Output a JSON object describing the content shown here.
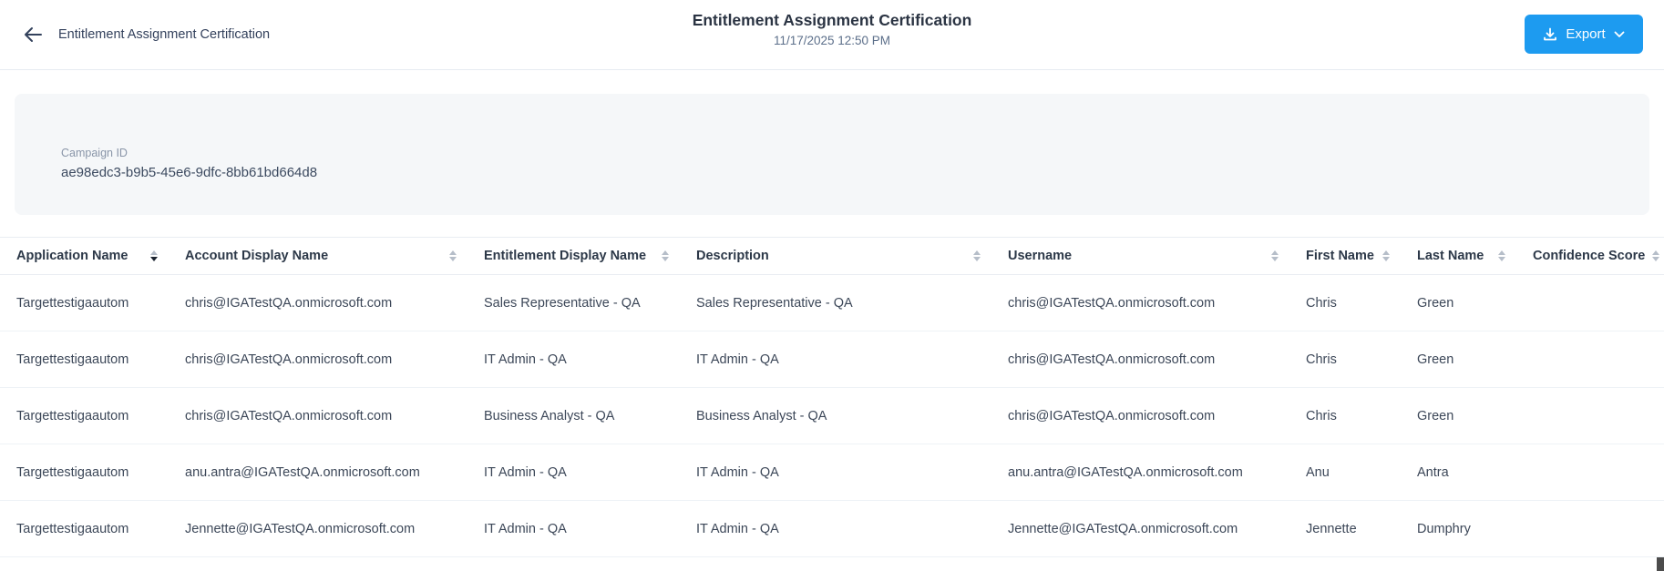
{
  "header": {
    "back_title": "Entitlement Assignment Certification",
    "title": "Entitlement Assignment Certification",
    "timestamp": "11/17/2025 12:50 PM",
    "export_label": "Export",
    "export_color": "#1d9bf0"
  },
  "campaign": {
    "label": "Campaign ID",
    "value": "ae98edc3-b9b5-45e6-9dfc-8bb61bd664d8"
  },
  "table": {
    "columns": [
      {
        "label": "Application Name",
        "sort": "desc"
      },
      {
        "label": "Account Display Name",
        "sort": "none"
      },
      {
        "label": "Entitlement Display Name",
        "sort": "none"
      },
      {
        "label": "Description",
        "sort": "none"
      },
      {
        "label": "Username",
        "sort": "none"
      },
      {
        "label": "First Name",
        "sort": "none"
      },
      {
        "label": "Last Name",
        "sort": "none"
      },
      {
        "label": "Confidence Score",
        "sort": "none"
      }
    ],
    "rows": [
      [
        "Targettestigaautom",
        "chris@IGATestQA.onmicrosoft.com",
        "Sales Representative - QA",
        "Sales Representative - QA",
        "chris@IGATestQA.onmicrosoft.com",
        "Chris",
        "Green",
        ""
      ],
      [
        "Targettestigaautom",
        "chris@IGATestQA.onmicrosoft.com",
        "IT Admin - QA",
        "IT Admin - QA",
        "chris@IGATestQA.onmicrosoft.com",
        "Chris",
        "Green",
        ""
      ],
      [
        "Targettestigaautom",
        "chris@IGATestQA.onmicrosoft.com",
        "Business Analyst - QA",
        "Business Analyst - QA",
        "chris@IGATestQA.onmicrosoft.com",
        "Chris",
        "Green",
        ""
      ],
      [
        "Targettestigaautom",
        "anu.antra@IGATestQA.onmicrosoft.com",
        "IT Admin - QA",
        "IT Admin - QA",
        "anu.antra@IGATestQA.onmicrosoft.com",
        "Anu",
        "Antra",
        ""
      ],
      [
        "Targettestigaautom",
        "Jennette@IGATestQA.onmicrosoft.com",
        "IT Admin - QA",
        "IT Admin - QA",
        "Jennette@IGATestQA.onmicrosoft.com",
        "Jennette",
        "Dumphry",
        ""
      ]
    ]
  }
}
